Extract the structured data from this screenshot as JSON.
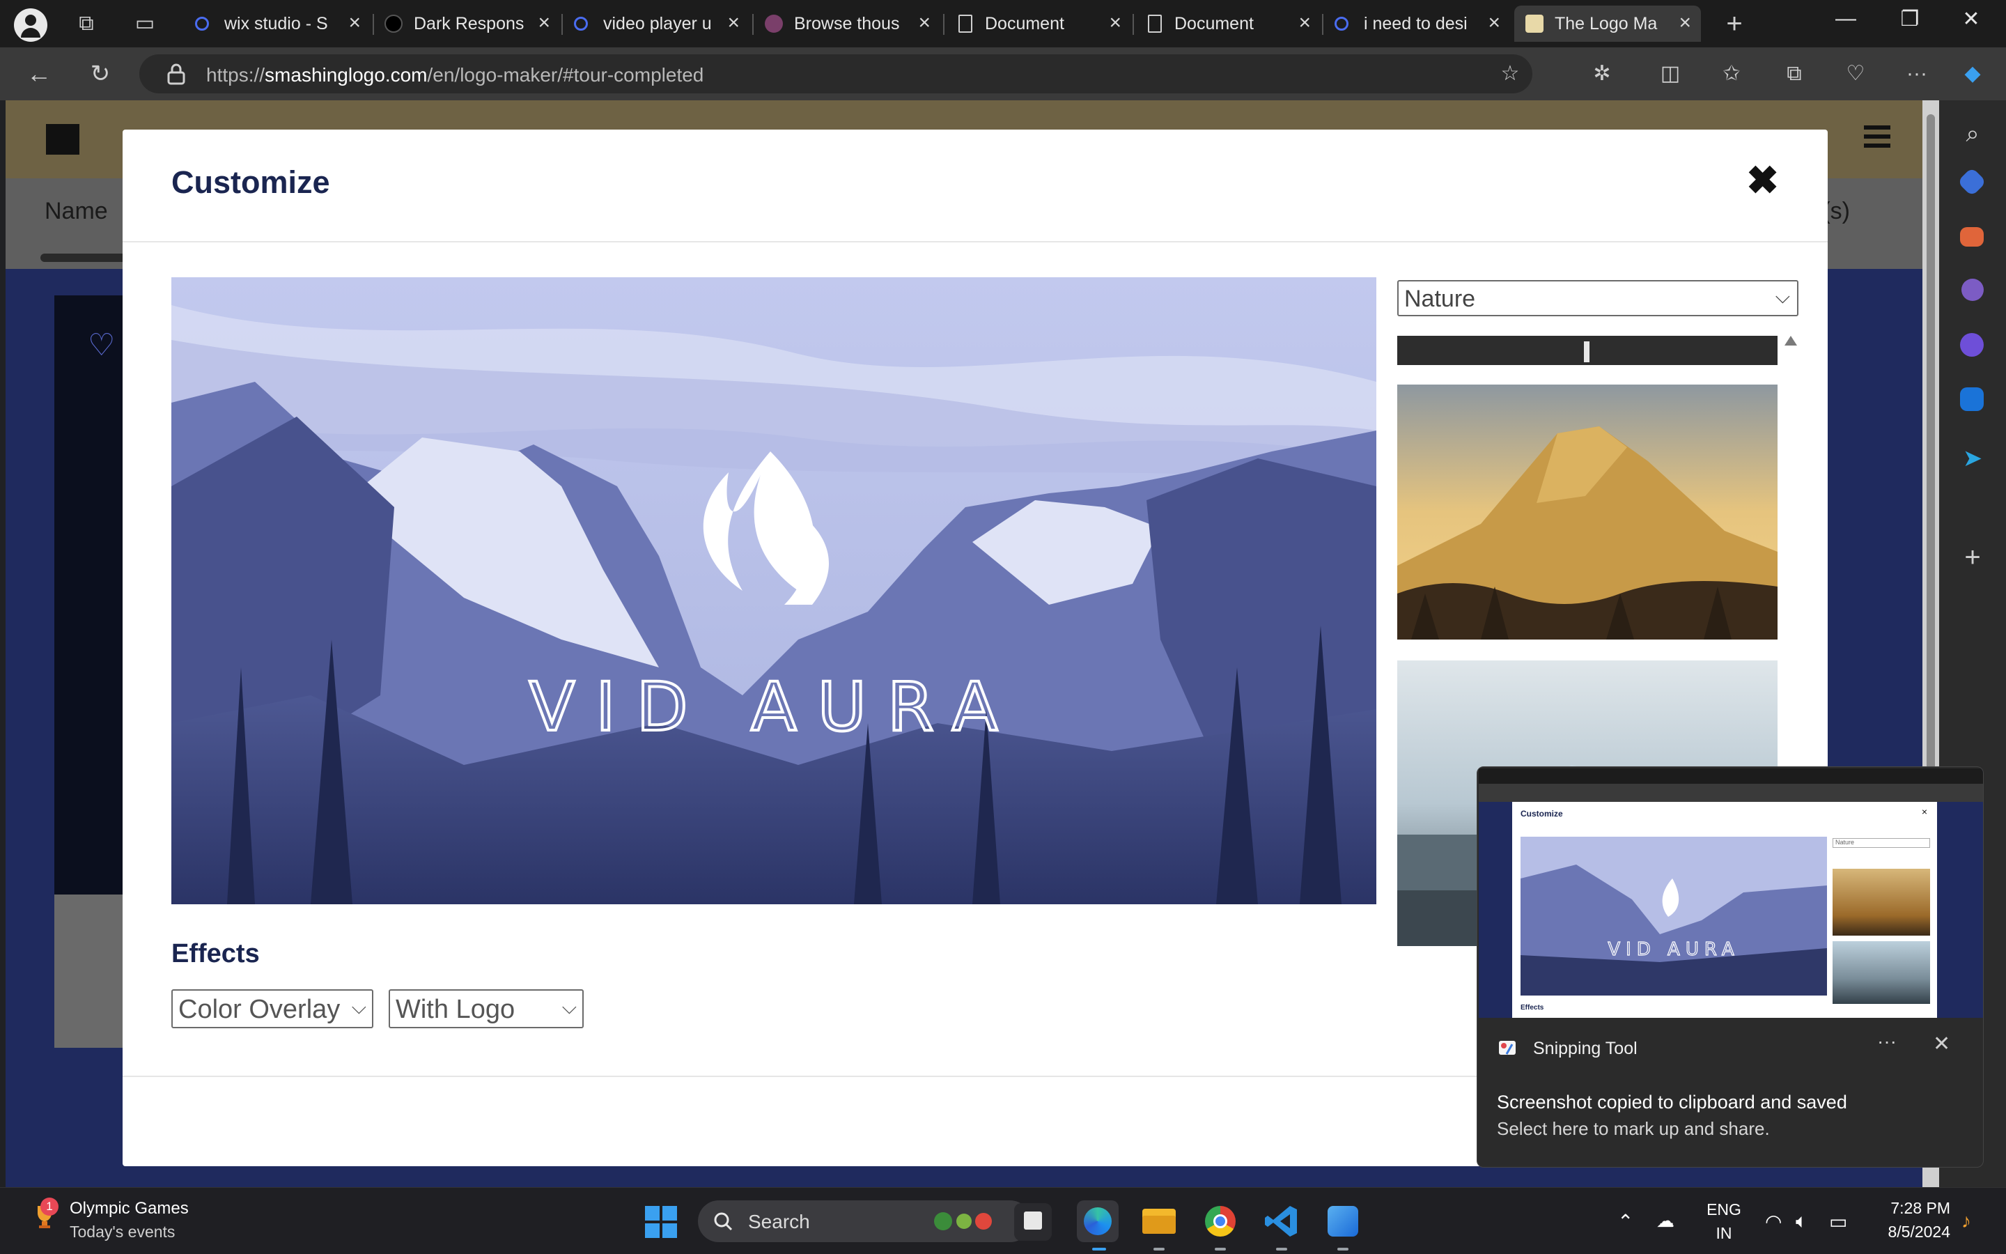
{
  "browser": {
    "tabs": [
      {
        "title": "wix studio - S",
        "active": false
      },
      {
        "title": "Dark Respons",
        "active": false
      },
      {
        "title": "video player u",
        "active": false
      },
      {
        "title": "Browse thous",
        "active": false
      },
      {
        "title": "Document",
        "active": false
      },
      {
        "title": "Document",
        "active": false
      },
      {
        "title": "i need to desi",
        "active": false
      },
      {
        "title": "The Logo Ma",
        "active": true
      }
    ],
    "url_prefix": "https://",
    "url_host": "smashinglogo.com",
    "url_path": "/en/logo-maker/#tour-completed"
  },
  "page": {
    "name_label": "Name",
    "right_label": "(s)"
  },
  "modal": {
    "title": "Customize",
    "close_glyph": "✖",
    "category_select": "Nature",
    "category_arrow": "⌵",
    "preview": {
      "brand_name": "VID AURA"
    },
    "effects_title": "Effects",
    "effect_select": "Color Overlay",
    "logo_select": "With Logo",
    "select_arrow": "⌵",
    "colors": {
      "title": "#1a2550",
      "overlay": "#7f88c4"
    }
  },
  "toast": {
    "mini_title": "Customize",
    "mini_close": "×",
    "mini_select": "Nature",
    "mini_effects": "Effects",
    "mini_brand": "VID AURA",
    "app_name": "Snipping Tool",
    "more_glyph": "···",
    "close_glyph": "✕",
    "message_line1": "Screenshot copied to clipboard and saved",
    "message_line2": "Select here to mark up and share."
  },
  "taskbar": {
    "widget_title": "Olympic Games",
    "widget_subtitle": "Today's events",
    "widget_badge": "1",
    "search_placeholder": "Search",
    "language": "ENG",
    "region": "IN",
    "time": "7:28 PM",
    "date": "8/5/2024"
  }
}
